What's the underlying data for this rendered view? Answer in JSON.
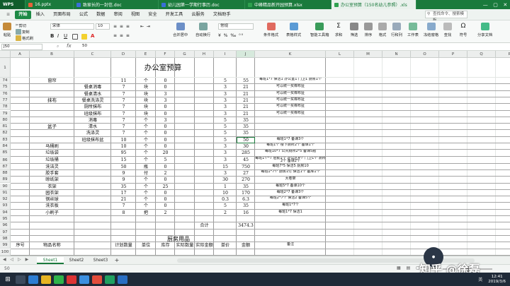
{
  "window_tabs": [
    {
      "label": "WPS",
      "color": "#2b9a4f"
    },
    {
      "label": "16.pptx",
      "color": "#e8623a"
    },
    {
      "label": "致家长的一封信.doc",
      "color": "#3a6fd8"
    },
    {
      "label": "幼儿园第一学期行事历.doc",
      "color": "#3a6fd8"
    },
    {
      "label": "中峰精品新开园预算.xlsx",
      "color": "#2fa14f"
    },
    {
      "label": "办公室预算（150名幼儿参照）.xls",
      "color": "#2fa14f"
    }
  ],
  "menus": [
    "开始",
    "插入",
    "页面布局",
    "公式",
    "数据",
    "审阅",
    "视图",
    "安全",
    "开发工具",
    "云服务",
    "文档助手"
  ],
  "search_placeholder": "查找命令、搜索模板",
  "ribbon": {
    "paste": "粘贴",
    "cut": "剪切",
    "copy": "复制",
    "format_painter": "格式刷",
    "font": "宋体",
    "size": "10",
    "bold": "B",
    "italic": "I",
    "underline": "U",
    "merge": "合并居中",
    "wrap": "自动换行",
    "numfmt": "常规",
    "cond": "条件格式",
    "tablestyle": "表格样式",
    "smart": "智能工具箱",
    "sum": "求和",
    "filter": "筛选",
    "sort": "排序",
    "format": "格式",
    "rowcol": "行和列",
    "sheet": "工作表",
    "freeze": "冻结窗格",
    "find": "查找",
    "symbol": "符号",
    "share": "分享文档"
  },
  "formula": {
    "cellref": "J50",
    "fx": "fx",
    "value": "50"
  },
  "columns": [
    "A",
    "B",
    "C",
    "D",
    "E",
    "F",
    "G",
    "H",
    "I",
    "J",
    "K",
    "L",
    "M",
    "N",
    "O",
    "P",
    "Q",
    "R",
    "S",
    "T",
    "U",
    "V"
  ],
  "title": "办公室预算",
  "row_numbers": [
    "1",
    "74",
    "75",
    "76",
    "77",
    "78",
    "79",
    "80",
    "81",
    "82",
    "83",
    "84",
    "85",
    "86",
    "87",
    "88",
    "89",
    "90",
    "91",
    "92",
    "93",
    "94",
    "95",
    "96",
    "97",
    "98",
    "99",
    "100"
  ],
  "rows": [
    {
      "b": "窗帘",
      "d": "11",
      "e": "个",
      "f": "0",
      "i": "5",
      "j": "55",
      "k": "每班1*7 保洁1 办公室1 门卫1 厨房1个"
    },
    {
      "c": "餐桌消毒",
      "d": "7",
      "e": "块",
      "f": "0",
      "i": "3",
      "j": "21",
      "k": "可以统一买棉布扯"
    },
    {
      "c": "餐桌清水",
      "d": "7",
      "e": "块",
      "f": "3",
      "i": "3",
      "j": "21",
      "k": "可以统一买棉布扯"
    },
    {
      "c": "餐桌洗涤灵",
      "d": "7",
      "e": "块",
      "f": "3",
      "i": "3",
      "j": "21",
      "k": "可以统一买棉布扯"
    },
    {
      "c": "厕所抹布",
      "d": "7",
      "e": "块",
      "f": "0",
      "i": "3",
      "j": "21",
      "k": "可以统一买棉布扯"
    },
    {
      "c": "班级抹布",
      "d": "7",
      "e": "块",
      "f": "0",
      "i": "3",
      "j": "21",
      "k": "可以统一买棉布扯"
    },
    {
      "c": "消毒",
      "d": "7",
      "e": "个",
      "f": "3",
      "i": "5",
      "j": "35",
      "k": ""
    },
    {
      "c": "清水",
      "d": "7",
      "e": "个",
      "f": "0",
      "i": "5",
      "j": "35",
      "k": ""
    },
    {
      "c": "洗涤灵",
      "d": "7",
      "e": "个",
      "f": "0",
      "i": "5",
      "j": "35",
      "k": ""
    },
    {
      "c": "班级抹布盆",
      "d": "10",
      "e": "个",
      "f": "0",
      "i": "5",
      "j": "50",
      "k": "每班1*7 备课3个"
    },
    {
      "b": "马桶刷",
      "d": "10",
      "e": "个",
      "f": "0",
      "i": "3",
      "j": "30",
      "k": "每班1个 楼下厕所2个 备课1个"
    },
    {
      "b": "垃圾袋",
      "d": "95",
      "e": "个",
      "f": "20",
      "i": "3",
      "j": "285",
      "k": "每班10*7 公共厕所2*5 备课5瓶"
    },
    {
      "b": "垃圾桶",
      "d": "15",
      "e": "个",
      "f": "5",
      "i": "3",
      "j": "45",
      "k": "每班1个*7 后勤1个 办公区4个 门卫1个 厕所2个 备课2个"
    },
    {
      "b": "洗洁灵",
      "d": "50",
      "e": "瓶",
      "f": "0",
      "i": "15",
      "j": "750",
      "k": "每班7*5 保洁5 厨房10"
    },
    {
      "b": "胶手套",
      "d": "9",
      "e": "付",
      "f": "2",
      "i": "3",
      "j": "27",
      "k": "每班1*7个 厨房1付 保洁1个 备库1个"
    },
    {
      "b": "晾纸架",
      "d": "9",
      "e": "个",
      "f": "0",
      "i": "30",
      "j": "270",
      "k": "大卷架"
    },
    {
      "b": "衣架",
      "d": "35",
      "e": "个",
      "f": "25",
      "i": "1",
      "j": "35",
      "k": "每班5*7 备课10个"
    },
    {
      "b": "园衣架",
      "d": "17",
      "e": "个",
      "f": "0",
      "i": "10",
      "j": "170",
      "k": "每班2*7 备课3个"
    },
    {
      "b": "钢丝球",
      "d": "21",
      "e": "个",
      "f": "0",
      "i": "0.3",
      "j": "6.3",
      "k": "每班2*7个 保洁2 备课5个"
    },
    {
      "b": "洗衣板",
      "d": "7",
      "e": "个",
      "f": "0",
      "i": "5",
      "j": "35",
      "k": "每班1*7个"
    },
    {
      "b": "小刷子",
      "d": "8",
      "e": "把",
      "f": "2",
      "i": "2",
      "j": "16",
      "k": "每班1*7 保洁1"
    },
    {},
    {
      "h": "合计",
      "j": "3474.3"
    },
    {},
    {
      "kitchen": "厨房用品"
    },
    {
      "a": "序号",
      "b": "物品名称",
      "d": "计划数量",
      "e": "单位",
      "f": "库存",
      "g": "实际数量",
      "h": "实际金额",
      "i": "单价",
      "j": "金额",
      "k": "备注"
    }
  ],
  "group_labels": {
    "mop": "抹布",
    "basin": "盆子"
  },
  "sheets": [
    "Sheet1",
    "Sheet2",
    "Sheet3"
  ],
  "zoom": "100%",
  "status_left": "50",
  "clock": {
    "time": "12:41",
    "date": "2019/3/6"
  },
  "watermark": "知乎 @徐磊",
  "taskbar_lang": "英"
}
